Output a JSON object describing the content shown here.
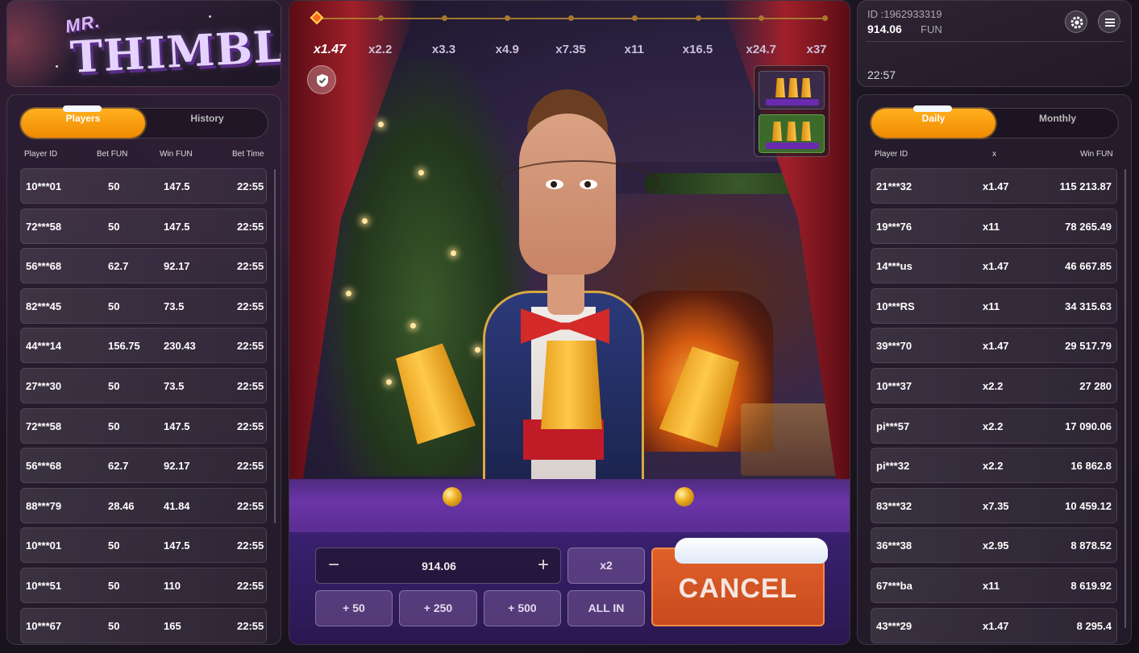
{
  "logo": {
    "top": "MR.",
    "main": "THIMBLE"
  },
  "players_panel": {
    "tabs": [
      {
        "label": "Players",
        "active": true
      },
      {
        "label": "History",
        "active": false
      }
    ],
    "columns": [
      "Player ID",
      "Bet  FUN",
      "Win  FUN",
      "Bet Time"
    ],
    "rows": [
      {
        "id": "10***01",
        "bet": "50",
        "win": "147.5",
        "time": "22:55"
      },
      {
        "id": "72***58",
        "bet": "50",
        "win": "147.5",
        "time": "22:55"
      },
      {
        "id": "56***68",
        "bet": "62.7",
        "win": "92.17",
        "time": "22:55"
      },
      {
        "id": "82***45",
        "bet": "50",
        "win": "73.5",
        "time": "22:55"
      },
      {
        "id": "44***14",
        "bet": "156.75",
        "win": "230.43",
        "time": "22:55"
      },
      {
        "id": "27***30",
        "bet": "50",
        "win": "73.5",
        "time": "22:55"
      },
      {
        "id": "72***58",
        "bet": "50",
        "win": "147.5",
        "time": "22:55"
      },
      {
        "id": "56***68",
        "bet": "62.7",
        "win": "92.17",
        "time": "22:55"
      },
      {
        "id": "88***79",
        "bet": "28.46",
        "win": "41.84",
        "time": "22:55"
      },
      {
        "id": "10***01",
        "bet": "50",
        "win": "147.5",
        "time": "22:55"
      },
      {
        "id": "10***51",
        "bet": "50",
        "win": "110",
        "time": "22:55"
      },
      {
        "id": "10***67",
        "bet": "50",
        "win": "165",
        "time": "22:55"
      }
    ]
  },
  "game": {
    "multipliers": [
      "x1.47",
      "x2.2",
      "x3.3",
      "x4.9",
      "x7.35",
      "x11",
      "x16.5",
      "x24.7",
      "x37"
    ],
    "current_multiplier_index": 0,
    "mode_options": [
      {
        "cups": 3,
        "selected": false
      },
      {
        "cups": 3,
        "selected": true
      }
    ],
    "icons": {
      "shield": "shield-check-icon"
    }
  },
  "controls": {
    "stake": "914.06",
    "minus": "−",
    "plus": "+",
    "double_label": "x2",
    "quick_bets": [
      "+ 50",
      "+ 250",
      "+ 500"
    ],
    "all_in_label": "ALL IN",
    "cancel_label": "CANCEL"
  },
  "account": {
    "id": "ID :1962933319",
    "balance": "914.06",
    "currency": "FUN",
    "time": "22:57",
    "icons": {
      "settings": "gear-icon",
      "menu": "menu-icon"
    }
  },
  "leaderboard": {
    "tabs": [
      {
        "label": "Daily",
        "active": true
      },
      {
        "label": "Monthly",
        "active": false
      }
    ],
    "columns": [
      "Player ID",
      "x",
      "Win  FUN"
    ],
    "rows": [
      {
        "id": "21***32",
        "x": "x1.47",
        "win": "115 213.87"
      },
      {
        "id": "19***76",
        "x": "x11",
        "win": "78 265.49"
      },
      {
        "id": "14***us",
        "x": "x1.47",
        "win": "46 667.85"
      },
      {
        "id": "10***RS",
        "x": "x11",
        "win": "34 315.63"
      },
      {
        "id": "39***70",
        "x": "x1.47",
        "win": "29 517.79"
      },
      {
        "id": "10***37",
        "x": "x2.2",
        "win": "27 280"
      },
      {
        "id": "pi***57",
        "x": "x2.2",
        "win": "17 090.06"
      },
      {
        "id": "pi***32",
        "x": "x2.2",
        "win": "16 862.8"
      },
      {
        "id": "83***32",
        "x": "x7.35",
        "win": "10 459.12"
      },
      {
        "id": "36***38",
        "x": "x2.95",
        "win": "8 878.52"
      },
      {
        "id": "67***ba",
        "x": "x11",
        "win": "8 619.92"
      },
      {
        "id": "43***29",
        "x": "x1.47",
        "win": "8 295.4"
      }
    ]
  }
}
